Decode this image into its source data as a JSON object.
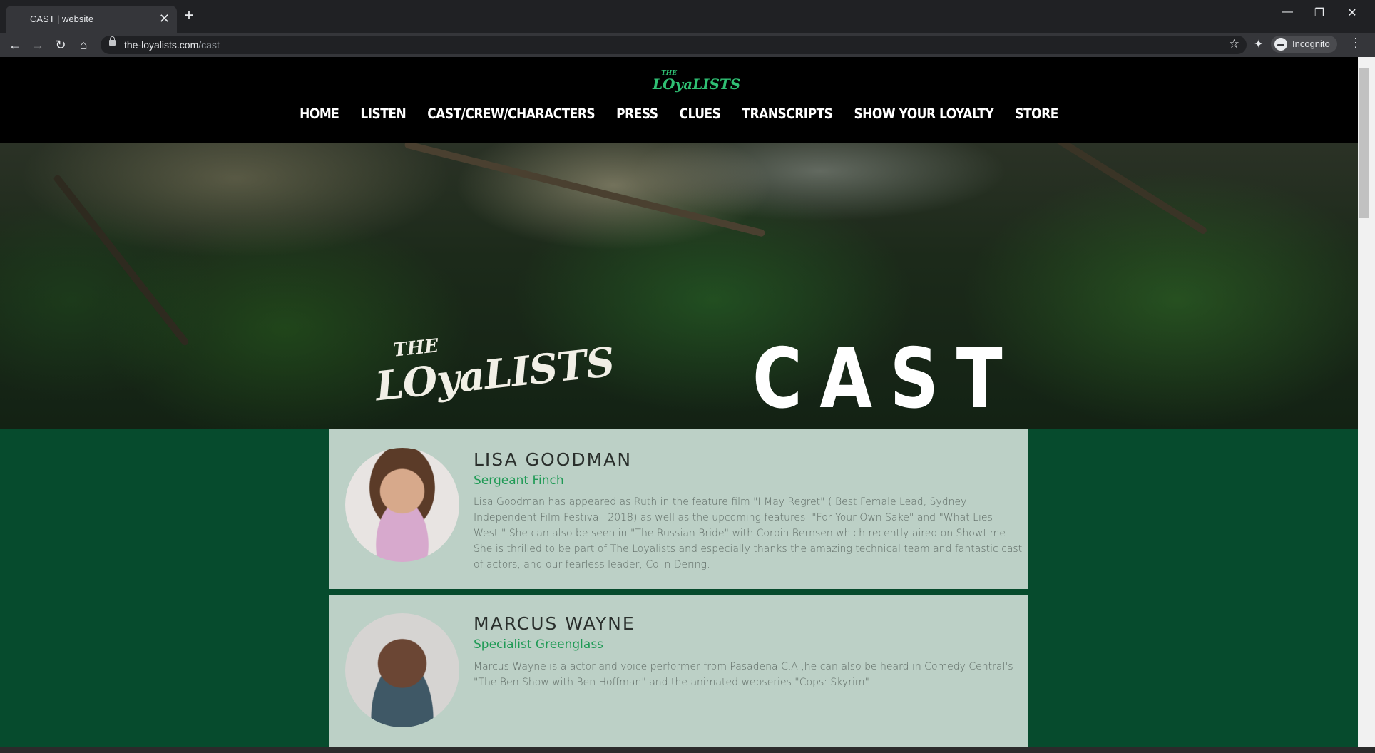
{
  "browser": {
    "tab_title": "CAST | website",
    "tab_close": "✕",
    "new_tab": "+",
    "url_host": "the-loyalists.com",
    "url_path": "/cast",
    "profile_label": "Incognito",
    "window_minimize": "—",
    "window_restore": "❐",
    "window_close": "✕"
  },
  "site": {
    "logo_the": "THE",
    "logo_name": "LOyaLISTS",
    "nav": [
      "HOME",
      "LISTEN",
      "CAST/CREW/CHARACTERS",
      "PRESS",
      "CLUES",
      "TRANSCRIPTS",
      "SHOW YOUR LOYALTY",
      "STORE"
    ],
    "hero_logo_the": "THE",
    "hero_logo_name": "LOyaLISTS",
    "hero_title": "CAST"
  },
  "cast": [
    {
      "name": "LISA GOODMAN",
      "role": "Sergeant Finch",
      "bio": "Lisa Goodman has appeared as Ruth in the feature film \"I May Regret\" ( Best Female Lead, Sydney Independent Film Festival, 2018) as well as the upcoming  features, \"For Your Own Sake\" and \"What Lies West.\" She can also be seen in \"The Russian Bride\" with Corbin Bernsen  which recently aired on Showtime.  She is thrilled to be part of  The Loyalists and especially thanks the amazing technical team and fantastic cast of actors, and our fearless leader, Colin Dering."
    },
    {
      "name": "MARCUS WAYNE",
      "role": "Specialist Greenglass",
      "bio": "Marcus Wayne is a actor and voice performer from Pasadena C.A ,he can also be heard in Comedy Central's \"The Ben Show with Ben Hoffman\" and the animated webseries \"Cops: Skyrim\""
    }
  ],
  "colors": {
    "page_bg": "#064b2d",
    "card_bg": "#bcd0c6",
    "accent_green": "#1f9a55",
    "logo_green": "#2fbf73"
  }
}
